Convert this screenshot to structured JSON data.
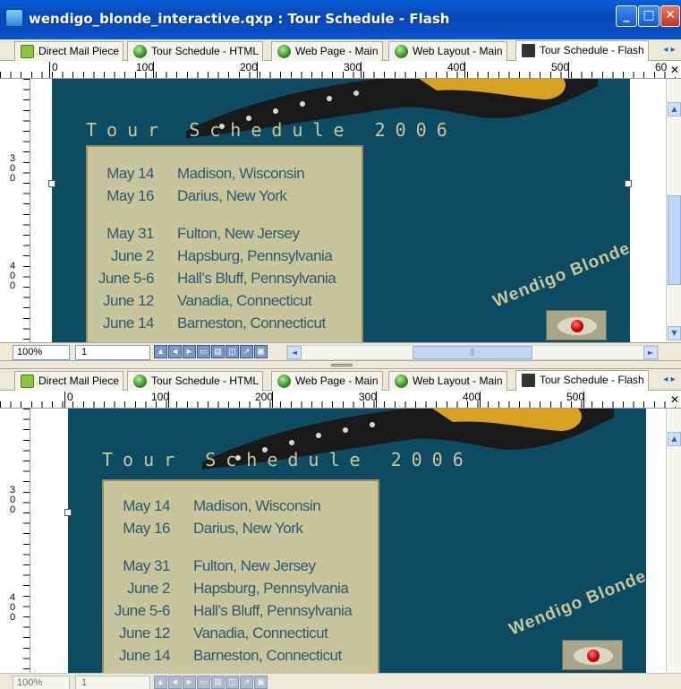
{
  "window": {
    "title": "wendigo_blonde_interactive.qxp : Tour Schedule - Flash",
    "minimize_glyph": "_",
    "maximize_glyph": "□",
    "close_glyph": "✕"
  },
  "tabs": [
    {
      "label": "Direct Mail Piece",
      "icon": "document-icon"
    },
    {
      "label": "Tour Schedule - HTML",
      "icon": "globe-icon"
    },
    {
      "label": "Web Page - Main",
      "icon": "globe-icon"
    },
    {
      "label": "Web Layout - Main",
      "icon": "globe-icon"
    },
    {
      "label": "Tour Schedule - Flash",
      "icon": "flash-icon",
      "active": true
    }
  ],
  "tab_scroll_glyphs": "◂ ▸",
  "ruler_close_glyph": "✕",
  "top_pane": {
    "ruler_labels": [
      "0",
      "100",
      "200",
      "300",
      "400",
      "500",
      "60"
    ],
    "vruler_labels": [
      "3\n0\n0",
      "4\n0\n0"
    ]
  },
  "bottom_pane": {
    "ruler_labels": [
      "0",
      "100",
      "200",
      "300",
      "400",
      "500"
    ],
    "vruler_labels": [
      "3\n0\n0",
      "4\n0\n0"
    ]
  },
  "page": {
    "title": "Tour Schedule 2006",
    "web_site_text": "Wendigo Blonde Web Site",
    "schedule": [
      {
        "date": "May 14",
        "city": "Madison, Wisconsin"
      },
      {
        "date": "May 16",
        "city": "Darius, New York"
      },
      {
        "date": "May 31",
        "city": "Fulton, New Jersey"
      },
      {
        "date": "June 2",
        "city": "Hapsburg, Pennsylvania"
      },
      {
        "date": "June 5-6",
        "city": "Hall’s Bluff, Pennsylvania"
      },
      {
        "date": "June 12",
        "city": "Vanadia, Connecticut"
      },
      {
        "date": "June 14",
        "city": "Barneston, Connecticut"
      }
    ]
  },
  "status": {
    "zoom": "100%",
    "page": "1",
    "hscroll_thumb_glyph": "⫼"
  },
  "colors": {
    "page_bg": "#0d4b62",
    "schedule_bg": "#c8c49c",
    "schedule_text": "#2b5a73",
    "title_text": "#c9c79a",
    "eye_red": "#cc0000"
  }
}
